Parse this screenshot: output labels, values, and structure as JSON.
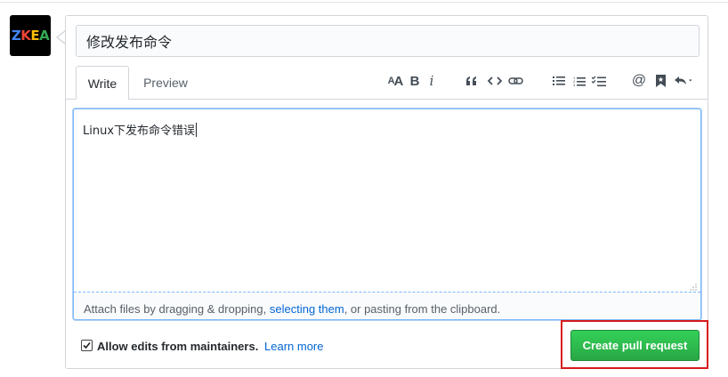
{
  "avatar": {
    "letters": [
      "Z",
      "K",
      "E",
      "A"
    ],
    "colors": [
      "#4285f4",
      "#ea4335",
      "#fbbc05",
      "#34a853"
    ]
  },
  "title_input": {
    "value": "修改发布命令"
  },
  "tabs": {
    "write": "Write",
    "preview": "Preview"
  },
  "toolbar": {
    "icons": [
      "text-size-icon",
      "bold-icon",
      "italic-icon",
      "quote-icon",
      "code-icon",
      "link-icon",
      "unordered-list-icon",
      "ordered-list-icon",
      "task-list-icon",
      "mention-icon",
      "saved-reply-icon",
      "reply-dropdown-icon"
    ],
    "text_size": "AA",
    "bold": "B",
    "italic": "i",
    "mention": "@"
  },
  "editor": {
    "text": "Linux下发布命令错误",
    "attach_prefix": "Attach files by dragging & dropping, ",
    "attach_link": "selecting them",
    "attach_suffix": ", or pasting from the clipboard."
  },
  "footer": {
    "allow_edits_checked": true,
    "allow_edits_label": "Allow edits from maintainers.",
    "learn_more": "Learn more",
    "create_button": "Create pull request"
  },
  "colors": {
    "accent_green": "#28a745",
    "link_blue": "#0366d6",
    "highlight_red": "#d7191c"
  }
}
